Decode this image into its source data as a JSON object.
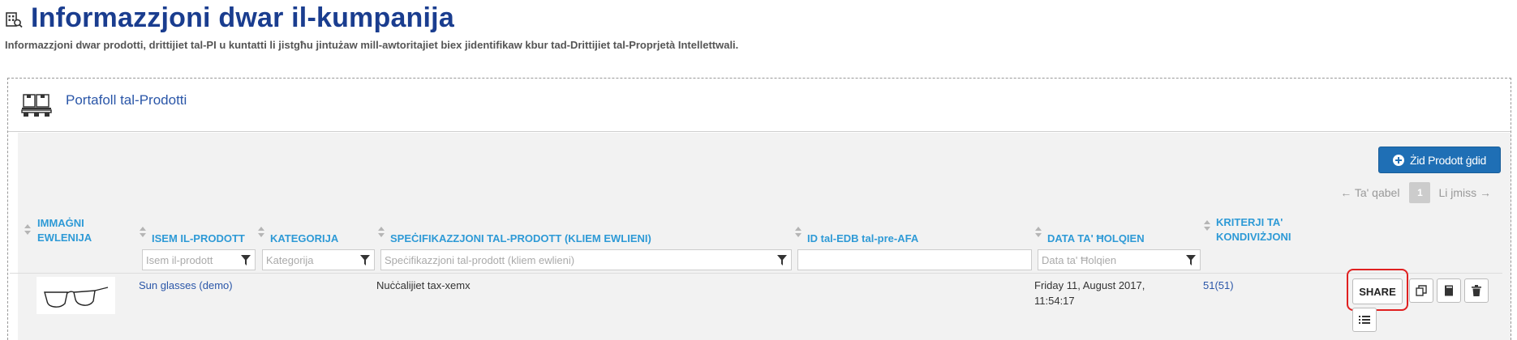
{
  "header": {
    "title": "Informazzjoni dwar il-kumpanija",
    "subtitle": "Informazzjoni dwar prodotti, drittijiet tal-PI u kuntatti li jistgħu jintużaw mill-awtoritajiet biex jidentifikaw kbur tad-Drittijiet tal-Proprjetà Intellettwali.",
    "icon": "building-icon"
  },
  "panel": {
    "title": "Portafoll tal-Prodotti",
    "icon": "products-pallet-icon"
  },
  "toolbar": {
    "add_label": "Żid Prodott ġdid",
    "add_icon": "plus-circle-icon"
  },
  "pager": {
    "prev_label": "← Ta' qabel",
    "current_page": "1",
    "next_label": "Li jmiss →"
  },
  "table": {
    "columns": [
      {
        "label": "IMMAĠNI EWLENIJA"
      },
      {
        "label": "ISEM IL-PRODOTT"
      },
      {
        "label": "KATEGORIJA"
      },
      {
        "label": "SPEĊIFIKAZZJONI TAL-PRODOTT (KLIEM EWLIENI)"
      },
      {
        "label": "ID tal-EDB tal-pre-AFA"
      },
      {
        "label": "DATA TA' ĦOLQIEN"
      },
      {
        "label": "KRITERJI TA' KONDIVIŻJONI"
      }
    ],
    "filters": {
      "name_placeholder": "Isem il-prodott",
      "category_placeholder": "Kategorija",
      "spec_placeholder": "Speċifikazzjoni tal-prodott (kliem ewlieni)",
      "edb_placeholder": "",
      "date_placeholder": "Data ta' Ħolqien"
    },
    "rows": [
      {
        "image": "sunglasses-thumbnail",
        "name": "Sun glasses (demo)",
        "category": "",
        "spec": "Nuċċalijiet tax-xemx",
        "edb_id": "",
        "date_line1": "Friday 11, August 2017,",
        "date_line2": "11:54:17",
        "criteria": "51(51)"
      }
    ]
  },
  "row_actions": {
    "share_label": "SHARE",
    "copy_icon": "copy-icon",
    "book_icon": "book-icon",
    "delete_icon": "trash-icon",
    "list_icon": "list-icon"
  },
  "colors": {
    "title": "#1a3d8f",
    "header_link": "#2e9ad6",
    "link": "#2a56a8",
    "primary_button": "#1f6fb5",
    "highlight": "#e02020"
  }
}
